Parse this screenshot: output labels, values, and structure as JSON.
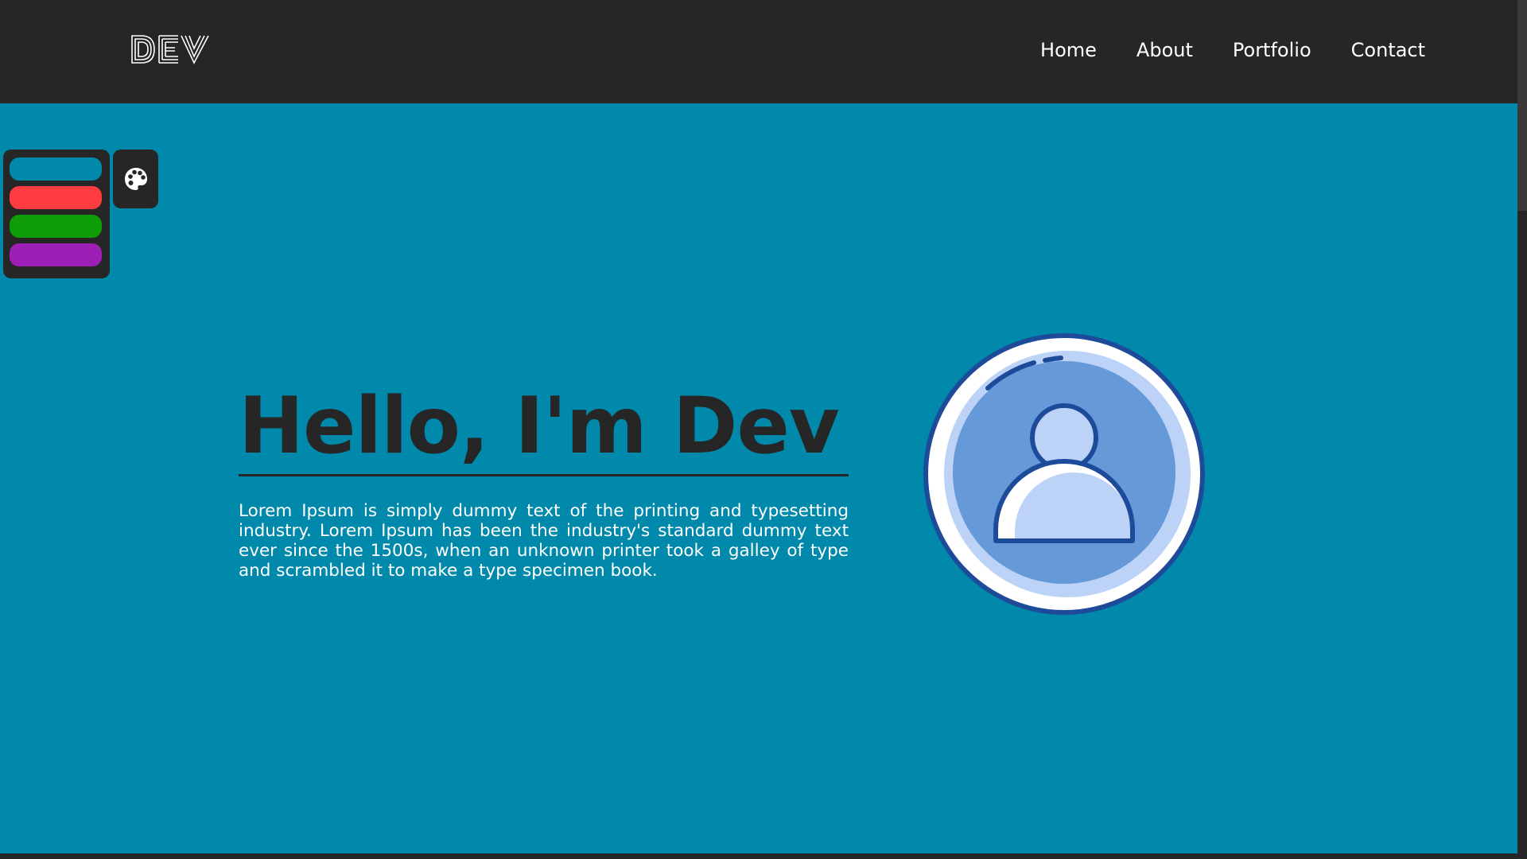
{
  "header": {
    "logo_text": "DEV",
    "nav": [
      "Home",
      "About",
      "Portfolio",
      "Contact"
    ]
  },
  "theme_switcher": {
    "swatches": [
      {
        "name": "teal",
        "color": "#0089ab"
      },
      {
        "name": "red",
        "color": "#ff3c41"
      },
      {
        "name": "green",
        "color": "#0f9d07"
      },
      {
        "name": "purple",
        "color": "#9e1fb5"
      }
    ],
    "toggle_icon": "palette-icon"
  },
  "hero": {
    "title": "Hello, I'm Dev",
    "description": "Lorem Ipsum is simply dummy text of the printing and typesetting industry. Lorem Ipsum has been the industry's standard dummy text ever since the 1500s, when an unknown printer took a galley of type and scrambled it to make a type specimen book.",
    "avatar_icon": "user-avatar-icon"
  },
  "colors": {
    "background": "#0089ab",
    "header": "#262626",
    "title": "#262626",
    "text": "#ffffff"
  }
}
